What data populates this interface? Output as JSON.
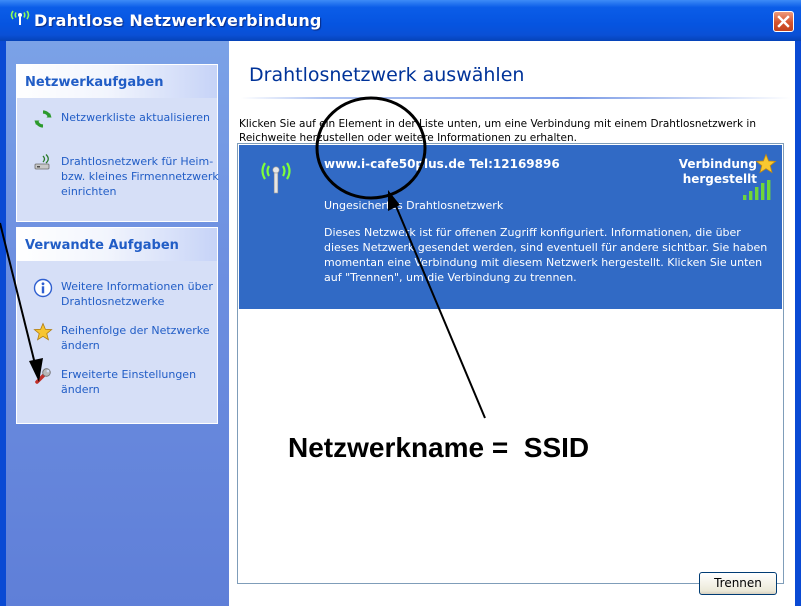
{
  "window": {
    "title": "Drahtlose Netzwerkverbindung",
    "close_label": "Schließen"
  },
  "sidebar": {
    "network_tasks": {
      "header": "Netzwerkaufgaben",
      "items": [
        {
          "label": "Netzwerkliste aktualisieren",
          "icon": "refresh-icon"
        },
        {
          "label": "Drahtlosnetzwerk für Heim- bzw. kleines Firmennetzwerk einrichten",
          "icon": "wireless-setup-icon"
        }
      ]
    },
    "related_tasks": {
      "header": "Verwandte Aufgaben",
      "items": [
        {
          "label": "Weitere Informationen über Drahtlosnetzwerke",
          "icon": "info-icon"
        },
        {
          "label": "Reihenfolge der Netzwerke ändern",
          "icon": "star-icon"
        },
        {
          "label": "Erweiterte Einstellungen ändern",
          "icon": "tools-icon"
        }
      ]
    }
  },
  "main": {
    "title": "Drahtlosnetzwerk auswählen",
    "instruction": "Klicken Sie auf ein Element in der Liste unten, um eine Verbindung mit einem Drahtlosnetzwerk in Reichweite herzustellen oder weitere Informationen zu erhalten.",
    "network": {
      "ssid": "www.i-cafe50plus.de Tel:12169896",
      "status": "Verbindung hergestellt",
      "security": "Ungesichertes Drahtlosnetzwerk",
      "description": "Dieses Netzwerk ist für offenen Zugriff konfiguriert. Informationen, die über dieses Netzwerk gesendet werden, sind eventuell für andere sichtbar. Sie haben momentan eine Verbindung mit diesem Netzwerk hergestellt. Klicken Sie unten auf \"Trennen\", um die Verbindung zu trennen.",
      "signal_icon": "wireless-antenna-icon",
      "strength_icon": "signal-bars-icon"
    },
    "disconnect_label": "Trennen"
  },
  "annotation": {
    "text": "Netzwerkname =  SSID"
  },
  "colors": {
    "title_blue": "#0654e0",
    "sidebar_blue": "#6d8fe0",
    "selection_blue": "#316ac5",
    "link_blue": "#215dc6",
    "heading_blue": "#003399"
  }
}
